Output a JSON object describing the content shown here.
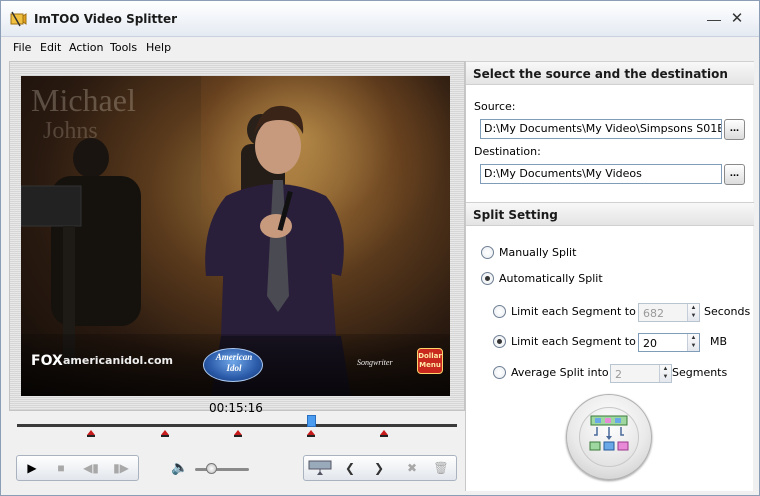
{
  "window": {
    "title": "ImTOO Video Splitter"
  },
  "menu": [
    "File",
    "Edit",
    "Action",
    "Tools",
    "Help"
  ],
  "video": {
    "overlay_name_line1": "Michael",
    "overlay_name_line2": "Johns",
    "network_logo": "FOX",
    "network_url": "americanidol.com",
    "show_logo_line1": "American",
    "show_logo_line2": "Idol",
    "sponsor_text": "Songwriter",
    "sponsor_logo_line1": "Dollar",
    "sponsor_logo_line2": "Menu"
  },
  "player": {
    "timecode": "00:15:16",
    "volume_level": 0.3
  },
  "panel": {
    "source_dest_header": "Select the source and the destination",
    "source_label": "Source:",
    "source_value": "D:\\My Documents\\My Video\\Simpsons S01E",
    "destination_label": "Destination:",
    "destination_value": "D:\\My Documents\\My Videos",
    "browse_label": "...",
    "split_header": "Split Setting",
    "manual_label": "Manually Split",
    "auto_label": "Automatically Split",
    "limit_seconds_label": "Limit each Segment to",
    "limit_seconds_value": "682",
    "limit_seconds_unit": "Seconds",
    "limit_mb_label": "Limit each Segment to",
    "limit_mb_value": "20",
    "limit_mb_unit": "MB",
    "average_label": "Average Split into",
    "average_value": "2",
    "average_unit": "Segments"
  },
  "colors": {
    "timeline_marker": "#c81c1c",
    "playhead": "#4a9cf0"
  }
}
